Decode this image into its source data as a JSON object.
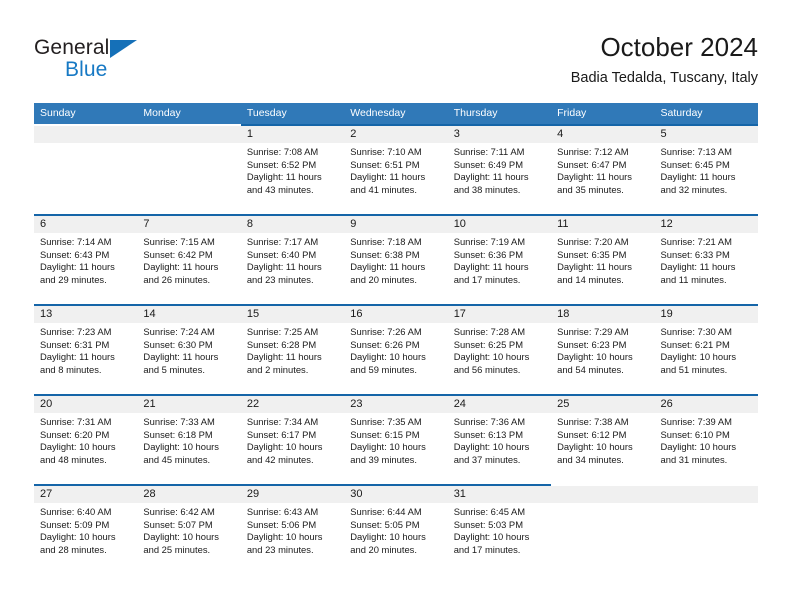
{
  "brand": {
    "line1": "General",
    "line2": "Blue",
    "triangle_color": "#1570b8"
  },
  "header": {
    "title": "October 2024",
    "subtitle": "Badia Tedalda, Tuscany, Italy"
  },
  "theme": {
    "header_blue": "#3079b8",
    "rule_blue": "#1565a8",
    "numband_gray": "#f0f0f0",
    "text": "#1a1a1a"
  },
  "weekdays": [
    "Sunday",
    "Monday",
    "Tuesday",
    "Wednesday",
    "Thursday",
    "Friday",
    "Saturday"
  ],
  "weeks": [
    [
      {
        "day": "",
        "sunrise": "",
        "sunset": "",
        "daylight1": "",
        "daylight2": "",
        "filled": false
      },
      {
        "day": "",
        "sunrise": "",
        "sunset": "",
        "daylight1": "",
        "daylight2": "",
        "filled": false
      },
      {
        "day": "1",
        "sunrise": "Sunrise: 7:08 AM",
        "sunset": "Sunset: 6:52 PM",
        "daylight1": "Daylight: 11 hours",
        "daylight2": "and 43 minutes.",
        "filled": true
      },
      {
        "day": "2",
        "sunrise": "Sunrise: 7:10 AM",
        "sunset": "Sunset: 6:51 PM",
        "daylight1": "Daylight: 11 hours",
        "daylight2": "and 41 minutes.",
        "filled": true
      },
      {
        "day": "3",
        "sunrise": "Sunrise: 7:11 AM",
        "sunset": "Sunset: 6:49 PM",
        "daylight1": "Daylight: 11 hours",
        "daylight2": "and 38 minutes.",
        "filled": true
      },
      {
        "day": "4",
        "sunrise": "Sunrise: 7:12 AM",
        "sunset": "Sunset: 6:47 PM",
        "daylight1": "Daylight: 11 hours",
        "daylight2": "and 35 minutes.",
        "filled": true
      },
      {
        "day": "5",
        "sunrise": "Sunrise: 7:13 AM",
        "sunset": "Sunset: 6:45 PM",
        "daylight1": "Daylight: 11 hours",
        "daylight2": "and 32 minutes.",
        "filled": true
      }
    ],
    [
      {
        "day": "6",
        "sunrise": "Sunrise: 7:14 AM",
        "sunset": "Sunset: 6:43 PM",
        "daylight1": "Daylight: 11 hours",
        "daylight2": "and 29 minutes.",
        "filled": true
      },
      {
        "day": "7",
        "sunrise": "Sunrise: 7:15 AM",
        "sunset": "Sunset: 6:42 PM",
        "daylight1": "Daylight: 11 hours",
        "daylight2": "and 26 minutes.",
        "filled": true
      },
      {
        "day": "8",
        "sunrise": "Sunrise: 7:17 AM",
        "sunset": "Sunset: 6:40 PM",
        "daylight1": "Daylight: 11 hours",
        "daylight2": "and 23 minutes.",
        "filled": true
      },
      {
        "day": "9",
        "sunrise": "Sunrise: 7:18 AM",
        "sunset": "Sunset: 6:38 PM",
        "daylight1": "Daylight: 11 hours",
        "daylight2": "and 20 minutes.",
        "filled": true
      },
      {
        "day": "10",
        "sunrise": "Sunrise: 7:19 AM",
        "sunset": "Sunset: 6:36 PM",
        "daylight1": "Daylight: 11 hours",
        "daylight2": "and 17 minutes.",
        "filled": true
      },
      {
        "day": "11",
        "sunrise": "Sunrise: 7:20 AM",
        "sunset": "Sunset: 6:35 PM",
        "daylight1": "Daylight: 11 hours",
        "daylight2": "and 14 minutes.",
        "filled": true
      },
      {
        "day": "12",
        "sunrise": "Sunrise: 7:21 AM",
        "sunset": "Sunset: 6:33 PM",
        "daylight1": "Daylight: 11 hours",
        "daylight2": "and 11 minutes.",
        "filled": true
      }
    ],
    [
      {
        "day": "13",
        "sunrise": "Sunrise: 7:23 AM",
        "sunset": "Sunset: 6:31 PM",
        "daylight1": "Daylight: 11 hours",
        "daylight2": "and 8 minutes.",
        "filled": true
      },
      {
        "day": "14",
        "sunrise": "Sunrise: 7:24 AM",
        "sunset": "Sunset: 6:30 PM",
        "daylight1": "Daylight: 11 hours",
        "daylight2": "and 5 minutes.",
        "filled": true
      },
      {
        "day": "15",
        "sunrise": "Sunrise: 7:25 AM",
        "sunset": "Sunset: 6:28 PM",
        "daylight1": "Daylight: 11 hours",
        "daylight2": "and 2 minutes.",
        "filled": true
      },
      {
        "day": "16",
        "sunrise": "Sunrise: 7:26 AM",
        "sunset": "Sunset: 6:26 PM",
        "daylight1": "Daylight: 10 hours",
        "daylight2": "and 59 minutes.",
        "filled": true
      },
      {
        "day": "17",
        "sunrise": "Sunrise: 7:28 AM",
        "sunset": "Sunset: 6:25 PM",
        "daylight1": "Daylight: 10 hours",
        "daylight2": "and 56 minutes.",
        "filled": true
      },
      {
        "day": "18",
        "sunrise": "Sunrise: 7:29 AM",
        "sunset": "Sunset: 6:23 PM",
        "daylight1": "Daylight: 10 hours",
        "daylight2": "and 54 minutes.",
        "filled": true
      },
      {
        "day": "19",
        "sunrise": "Sunrise: 7:30 AM",
        "sunset": "Sunset: 6:21 PM",
        "daylight1": "Daylight: 10 hours",
        "daylight2": "and 51 minutes.",
        "filled": true
      }
    ],
    [
      {
        "day": "20",
        "sunrise": "Sunrise: 7:31 AM",
        "sunset": "Sunset: 6:20 PM",
        "daylight1": "Daylight: 10 hours",
        "daylight2": "and 48 minutes.",
        "filled": true
      },
      {
        "day": "21",
        "sunrise": "Sunrise: 7:33 AM",
        "sunset": "Sunset: 6:18 PM",
        "daylight1": "Daylight: 10 hours",
        "daylight2": "and 45 minutes.",
        "filled": true
      },
      {
        "day": "22",
        "sunrise": "Sunrise: 7:34 AM",
        "sunset": "Sunset: 6:17 PM",
        "daylight1": "Daylight: 10 hours",
        "daylight2": "and 42 minutes.",
        "filled": true
      },
      {
        "day": "23",
        "sunrise": "Sunrise: 7:35 AM",
        "sunset": "Sunset: 6:15 PM",
        "daylight1": "Daylight: 10 hours",
        "daylight2": "and 39 minutes.",
        "filled": true
      },
      {
        "day": "24",
        "sunrise": "Sunrise: 7:36 AM",
        "sunset": "Sunset: 6:13 PM",
        "daylight1": "Daylight: 10 hours",
        "daylight2": "and 37 minutes.",
        "filled": true
      },
      {
        "day": "25",
        "sunrise": "Sunrise: 7:38 AM",
        "sunset": "Sunset: 6:12 PM",
        "daylight1": "Daylight: 10 hours",
        "daylight2": "and 34 minutes.",
        "filled": true
      },
      {
        "day": "26",
        "sunrise": "Sunrise: 7:39 AM",
        "sunset": "Sunset: 6:10 PM",
        "daylight1": "Daylight: 10 hours",
        "daylight2": "and 31 minutes.",
        "filled": true
      }
    ],
    [
      {
        "day": "27",
        "sunrise": "Sunrise: 6:40 AM",
        "sunset": "Sunset: 5:09 PM",
        "daylight1": "Daylight: 10 hours",
        "daylight2": "and 28 minutes.",
        "filled": true
      },
      {
        "day": "28",
        "sunrise": "Sunrise: 6:42 AM",
        "sunset": "Sunset: 5:07 PM",
        "daylight1": "Daylight: 10 hours",
        "daylight2": "and 25 minutes.",
        "filled": true
      },
      {
        "day": "29",
        "sunrise": "Sunrise: 6:43 AM",
        "sunset": "Sunset: 5:06 PM",
        "daylight1": "Daylight: 10 hours",
        "daylight2": "and 23 minutes.",
        "filled": true
      },
      {
        "day": "30",
        "sunrise": "Sunrise: 6:44 AM",
        "sunset": "Sunset: 5:05 PM",
        "daylight1": "Daylight: 10 hours",
        "daylight2": "and 20 minutes.",
        "filled": true
      },
      {
        "day": "31",
        "sunrise": "Sunrise: 6:45 AM",
        "sunset": "Sunset: 5:03 PM",
        "daylight1": "Daylight: 10 hours",
        "daylight2": "and 17 minutes.",
        "filled": true
      },
      {
        "day": "",
        "sunrise": "",
        "sunset": "",
        "daylight1": "",
        "daylight2": "",
        "filled": false
      },
      {
        "day": "",
        "sunrise": "",
        "sunset": "",
        "daylight1": "",
        "daylight2": "",
        "filled": false
      }
    ]
  ]
}
